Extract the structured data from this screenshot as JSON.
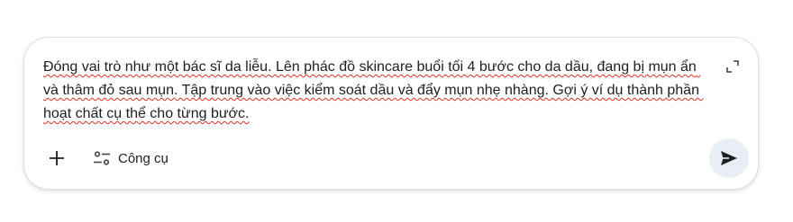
{
  "composer": {
    "prompt_text": "Đóng vai trò như một bác sĩ da liễu. Lên phác đồ skincare buổi tối 4 bước cho da dầu, đang bị mụn ẩn và thâm đỏ sau mụn. Tập trung vào việc kiểm soát dầu và đẩy mụn nhẹ nhàng. Gợi ý ví dụ thành phần hoạt chất cụ thể cho từng bước.",
    "tools_label": "Công cụ"
  },
  "icons": {
    "expand": "expand-icon",
    "add": "plus-icon",
    "tools": "tune-icon",
    "send": "send-icon"
  },
  "colors": {
    "text": "#1f1f1f",
    "spellcheck_underline": "#d93025",
    "send_button_bg": "#e9eef6",
    "border": "#dcdfe3"
  }
}
